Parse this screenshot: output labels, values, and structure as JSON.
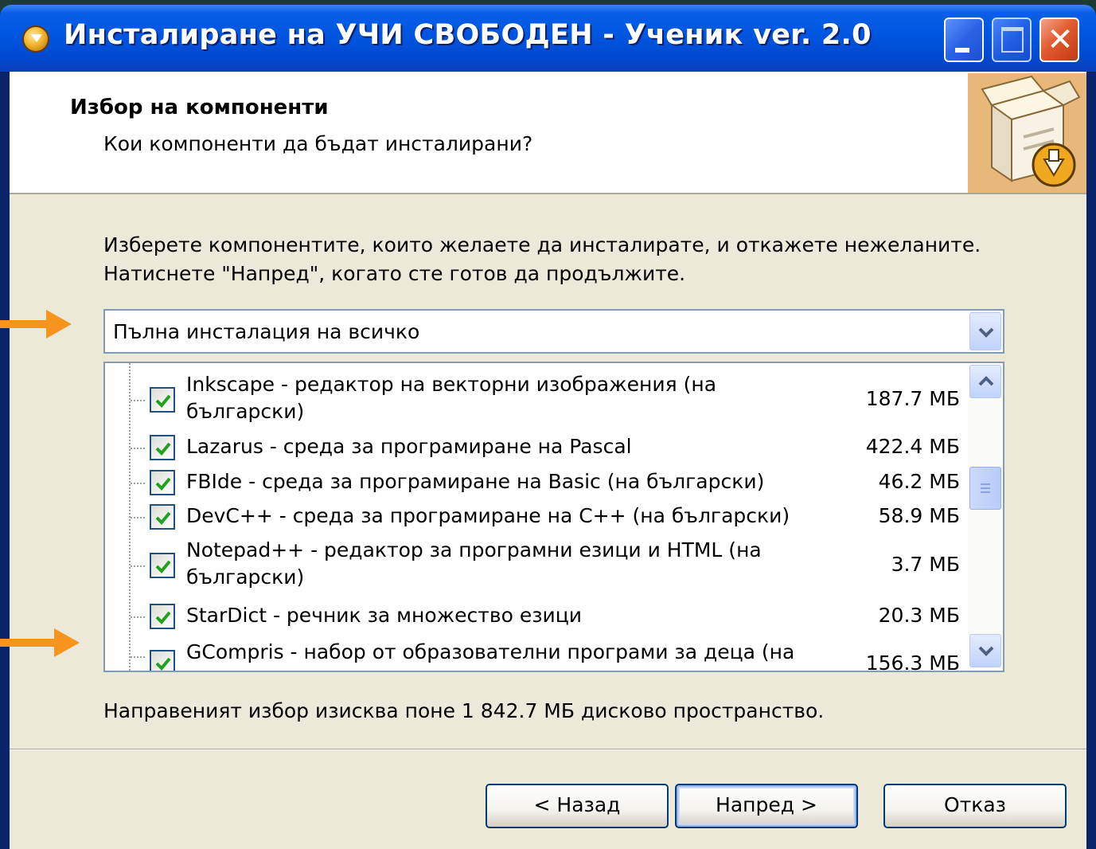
{
  "window": {
    "title": "Инсталиране на УЧИ СВОБОДЕН - Ученик ver. 2.0",
    "titlebar_color": "#0054e3"
  },
  "header": {
    "title": "Избор на компоненти",
    "subtitle": "Кои компоненти да бъдат инсталирани?"
  },
  "description": {
    "line1": "Изберете компонентите, които желаете да инсталирате, и откажете нежеланите.",
    "line2": "Натиснете \"Напред\", когато сте готов да продължите."
  },
  "install_type": {
    "selected": "Пълна инсталация на всичко"
  },
  "components": [
    {
      "line1": "Inkscape - редактор на векторни изображения (на",
      "line2": "български)",
      "size": "187.7 МБ",
      "checked": true
    },
    {
      "line1": "Lazarus - среда за програмиране на Pascal",
      "line2": "",
      "size": "422.4 МБ",
      "checked": true
    },
    {
      "line1": "FBIde - среда за програмиране на Basic (на български)",
      "line2": "",
      "size": "46.2 МБ",
      "checked": true
    },
    {
      "line1": "DevC++ - среда за програмиране на C++ (на български)",
      "line2": "",
      "size": "58.9 МБ",
      "checked": true
    },
    {
      "line1": "Notepad++ - редактор за програмни езици и HTML (на",
      "line2": "български)",
      "size": "3.7 МБ",
      "checked": true
    },
    {
      "line1": "StarDict - речник за множество езици",
      "line2": "",
      "size": "20.3 МБ",
      "checked": true
    },
    {
      "line1": "GCompris - набор от образователни програми за деца (на",
      "line2": "",
      "size": "156.3 МБ",
      "checked": true
    }
  ],
  "space_required": "Направеният избор изисква поне 1 842.7 МБ дисково пространство.",
  "buttons": {
    "back": "< Назад",
    "next": "Напред >",
    "cancel": "Отказ"
  },
  "accent_color": "#f7941d"
}
